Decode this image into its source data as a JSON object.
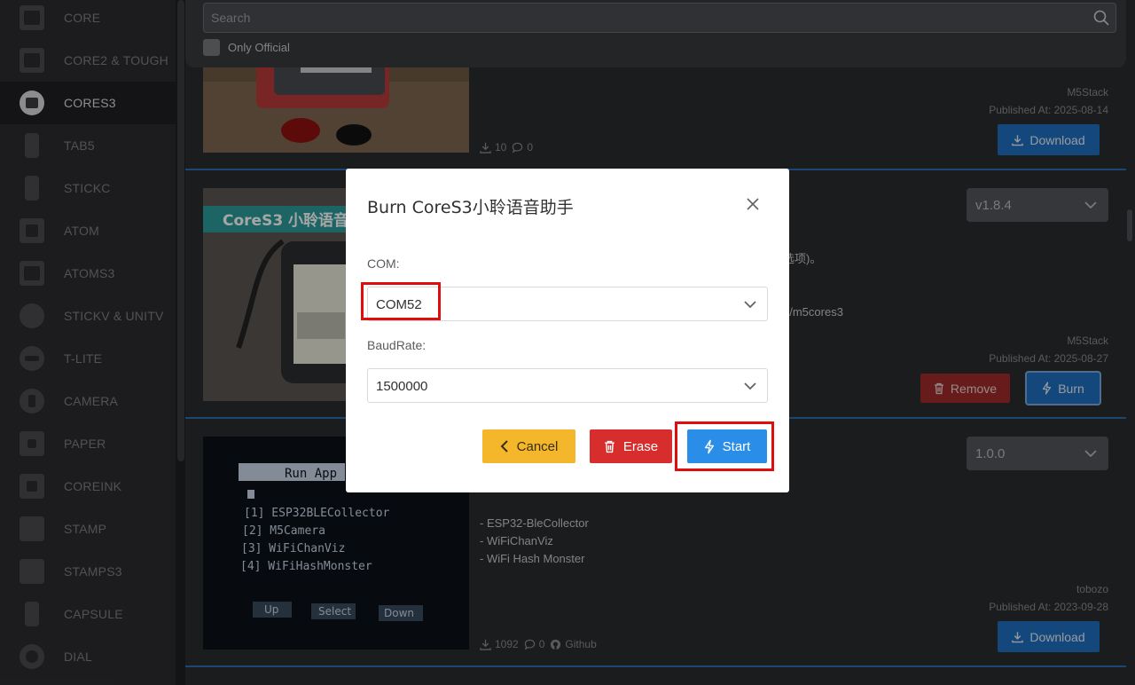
{
  "sidebar": {
    "items": [
      {
        "label": "CORE",
        "icon": "core-device-icon"
      },
      {
        "label": "CORE2 & TOUGH",
        "icon": "core2-device-icon"
      },
      {
        "label": "CORES3",
        "icon": "cores3-device-icon",
        "active": true
      },
      {
        "label": "TAB5",
        "icon": "tab5-device-icon"
      },
      {
        "label": "STICKC",
        "icon": "stickc-device-icon"
      },
      {
        "label": "ATOM",
        "icon": "atom-device-icon"
      },
      {
        "label": "ATOMS3",
        "icon": "atoms3-device-icon"
      },
      {
        "label": "STICKV & UNITV",
        "icon": "stickv-device-icon"
      },
      {
        "label": "T-LITE",
        "icon": "tlite-device-icon"
      },
      {
        "label": "CAMERA",
        "icon": "camera-device-icon"
      },
      {
        "label": "PAPER",
        "icon": "paper-device-icon"
      },
      {
        "label": "COREINK",
        "icon": "coreink-device-icon"
      },
      {
        "label": "STAMP",
        "icon": "stamp-device-icon"
      },
      {
        "label": "STAMPS3",
        "icon": "stamps3-device-icon"
      },
      {
        "label": "CAPSULE",
        "icon": "capsule-device-icon"
      },
      {
        "label": "DIAL",
        "icon": "dial-device-icon"
      }
    ]
  },
  "search": {
    "placeholder": "Search",
    "only_official_label": "Only Official"
  },
  "cards": [
    {
      "author": "M5Stack",
      "published": "Published At: 2025-08-14",
      "downloads": "10",
      "comments": "0",
      "download_label": "Download"
    },
    {
      "version": "v1.8.4",
      "desc_fragment_1": "选项)。",
      "desc_fragment_2": "g/m5cores3",
      "author": "M5Stack",
      "published": "Published At: 2025-08-27",
      "remove_label": "Remove",
      "burn_label": "Burn",
      "image_banner": "CoreS3 小聆语音"
    },
    {
      "version": "1.0.0",
      "desc_lines": [
        "- ESP32-BleCollector",
        "- WiFiChanViz",
        "- WiFi Hash Monster"
      ],
      "author": "tobozo",
      "published": "Published At: 2023-09-28",
      "downloads": "1092",
      "comments": "0",
      "github_label": "Github",
      "download_label": "Download",
      "screen_title": "Run App",
      "screen_items": [
        "[1] ESP32BLECollector",
        "[2] M5Camera",
        "[3] WiFiChanViz",
        "[4] WiFiHashMonster"
      ],
      "screen_buttons": [
        "Up",
        "Select",
        "Down"
      ]
    }
  ],
  "modal": {
    "title": "Burn CoreS3小聆语音助手",
    "com_label": "COM:",
    "com_value": "COM52",
    "baud_label": "BaudRate:",
    "baud_value": "1500000",
    "cancel_label": "Cancel",
    "erase_label": "Erase",
    "start_label": "Start"
  },
  "colors": {
    "highlight": "#e00d0d",
    "start_button": "#2a8ee8",
    "erase_button": "#d82d2d",
    "cancel_button": "#f4b62a",
    "download_button": "#1f6fc0"
  }
}
